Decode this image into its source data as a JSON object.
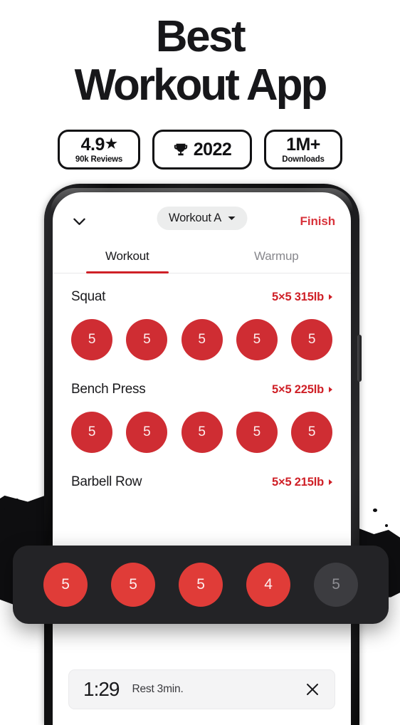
{
  "hero": {
    "line1": "Best",
    "line2": "Workout App"
  },
  "badges": [
    {
      "name": "rating",
      "value": "4.9",
      "icon": "star-icon",
      "caption": "90k Reviews"
    },
    {
      "name": "award",
      "value": "2022",
      "icon": "trophy-icon",
      "caption": ""
    },
    {
      "name": "downloads",
      "value": "1M+",
      "icon": "",
      "caption": "Downloads"
    }
  ],
  "app": {
    "topbar": {
      "collapse_icon": "chevron-down-icon",
      "workout_selector": "Workout A",
      "workout_selector_icon": "caret-down-icon",
      "finish_label": "Finish"
    },
    "tabs": [
      {
        "label": "Workout",
        "active": true
      },
      {
        "label": "Warmup",
        "active": false
      }
    ],
    "exercises": [
      {
        "name": "Squat",
        "meta": "5×5 315lb",
        "sets": [
          {
            "reps": "5",
            "state": "done"
          },
          {
            "reps": "5",
            "state": "done"
          },
          {
            "reps": "5",
            "state": "done"
          },
          {
            "reps": "5",
            "state": "done"
          },
          {
            "reps": "5",
            "state": "done"
          }
        ]
      },
      {
        "name": "Bench Press",
        "meta": "5×5 225lb",
        "sets": [
          {
            "reps": "5",
            "state": "done"
          },
          {
            "reps": "5",
            "state": "done"
          },
          {
            "reps": "5",
            "state": "done"
          },
          {
            "reps": "5",
            "state": "done"
          },
          {
            "reps": "5",
            "state": "done"
          }
        ]
      },
      {
        "name": "Barbell Row",
        "meta": "5×5 215lb",
        "sets": []
      }
    ],
    "highlight_card": {
      "sets": [
        {
          "reps": "5",
          "state": "done"
        },
        {
          "reps": "5",
          "state": "done"
        },
        {
          "reps": "5",
          "state": "done"
        },
        {
          "reps": "4",
          "state": "done"
        },
        {
          "reps": "5",
          "state": "pending"
        }
      ]
    },
    "rest_timer": {
      "time": "1:29",
      "label": "Rest 3min.",
      "close_icon": "close-icon"
    }
  },
  "colors": {
    "brand_red": "#cf2027",
    "set_dot_red": "#cf2d33",
    "dark_card": "#232326",
    "muted_dot": "#3c3c40",
    "text_dark": "#1a1a1d"
  }
}
